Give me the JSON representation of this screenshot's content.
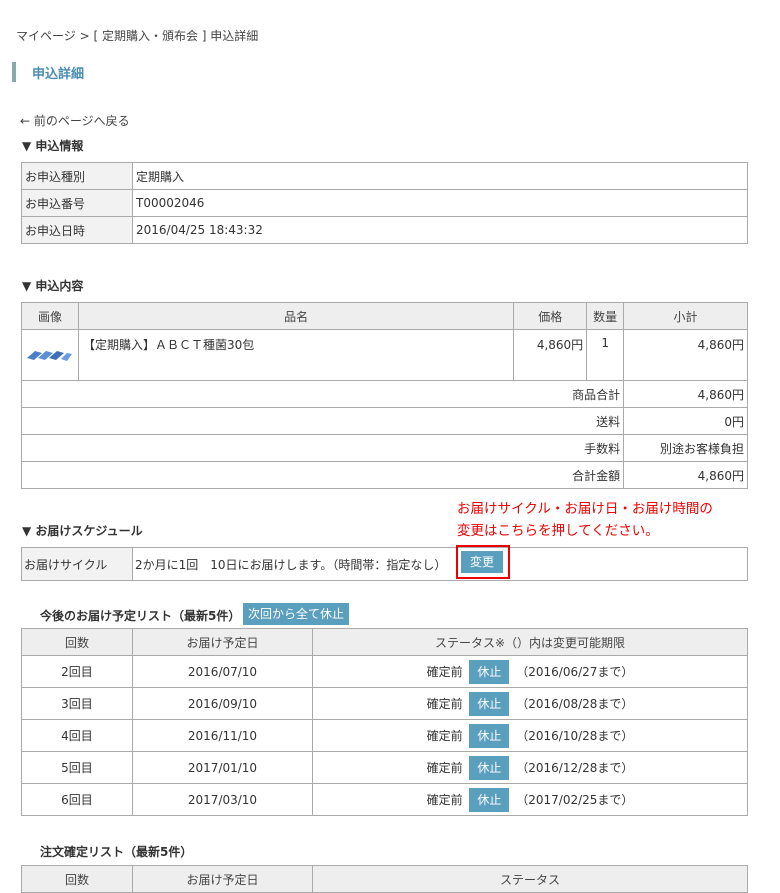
{
  "breadcrumb": "マイページ > [ 定期購入・頒布会 ] 申込詳細",
  "page_title": "申込詳細",
  "back_link": "← 前のページへ戻る",
  "section_info": {
    "heading": "▼ 申込情報",
    "rows": [
      {
        "label": "お申込種別",
        "value": "定期購入"
      },
      {
        "label": "お申込番号",
        "value": "T00002046"
      },
      {
        "label": "お申込日時",
        "value": "2016/04/25 18:43:32"
      }
    ]
  },
  "section_order": {
    "heading": "▼ 申込内容",
    "headers": {
      "image": "画像",
      "name": "品名",
      "price": "価格",
      "qty": "数量",
      "subtotal": "小計"
    },
    "item": {
      "name": "【定期購入】ＡＢＣＴ種菌30包",
      "price": "4,860円",
      "qty": "1",
      "subtotal": "4,860円"
    },
    "totals": [
      {
        "label": "商品合計",
        "value": "4,860円"
      },
      {
        "label": "送料",
        "value": "0円"
      },
      {
        "label": "手数料",
        "value": "別途お客様負担"
      },
      {
        "label": "合計金額",
        "value": "4,860円"
      }
    ]
  },
  "section_schedule": {
    "heading": "▼ お届けスケジュール",
    "note_line1": "お届けサイクル・お届け日・お届け時間の",
    "note_line2": "変更はこちらを押してください。",
    "label": "お届けサイクル",
    "value": "2か月に1回　10日にお届けします。（時間帯：指定なし）",
    "change_button": "変更"
  },
  "future_list": {
    "heading": "今後のお届け予定リスト（最新5件）",
    "skip_all_button": "次回から全て休止",
    "headers": {
      "count": "回数",
      "date": "お届け予定日",
      "status": "ステータス※（）内は変更可能期限"
    },
    "rows": [
      {
        "count": "2回目",
        "date": "2016/07/10",
        "status": "確定前",
        "button": "休止",
        "deadline": "（2016/06/27まで）"
      },
      {
        "count": "3回目",
        "date": "2016/09/10",
        "status": "確定前",
        "button": "休止",
        "deadline": "（2016/08/28まで）"
      },
      {
        "count": "4回目",
        "date": "2016/11/10",
        "status": "確定前",
        "button": "休止",
        "deadline": "（2016/10/28まで）"
      },
      {
        "count": "5回目",
        "date": "2017/01/10",
        "status": "確定前",
        "button": "休止",
        "deadline": "（2016/12/28まで）"
      },
      {
        "count": "6回目",
        "date": "2017/03/10",
        "status": "確定前",
        "button": "休止",
        "deadline": "（2017/02/25まで）"
      }
    ]
  },
  "confirmed_list": {
    "heading": "注文確定リスト（最新5件）",
    "headers": {
      "count": "回数",
      "date": "お届け予定日",
      "status": "ステータス"
    }
  }
}
